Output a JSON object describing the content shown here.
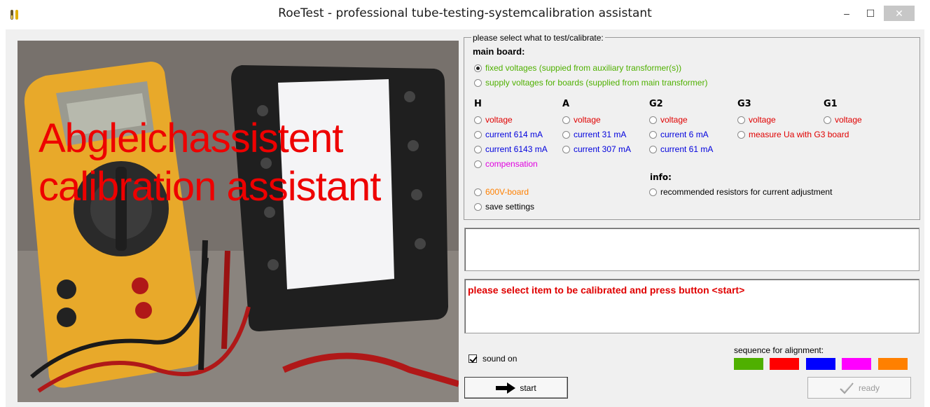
{
  "window": {
    "title": "RoeTest - professional tube-testing-systemcalibration assistant",
    "minimize": "–",
    "maximize": "☐",
    "close": "✕"
  },
  "photo": {
    "overlay_line1": "Abgleichassistent",
    "overlay_line2": "calibration assistant",
    "overlay_color": "#ee0000"
  },
  "groupbox": {
    "legend": "please select what to test/calibrate:",
    "main_board": {
      "title": "main board:",
      "options": [
        {
          "label": "fixed voltages (suppied from auxiliary transformer(s))",
          "checked": true
        },
        {
          "label": "supply voltages for boards (supplied from main transformer)",
          "checked": false
        }
      ]
    },
    "columns": {
      "H": {
        "heading": "H",
        "options": [
          "voltage",
          "current 614 mA",
          "current 6143 mA",
          "compensation"
        ]
      },
      "A": {
        "heading": "A",
        "options": [
          "voltage",
          "current 31 mA",
          "current 307 mA"
        ]
      },
      "G2": {
        "heading": "G2",
        "options": [
          "voltage",
          "current 6 mA",
          "current 61 mA"
        ]
      },
      "G3": {
        "heading": "G3",
        "options": [
          "voltage",
          "measure Ua with G3 board"
        ]
      },
      "G1": {
        "heading": "G1",
        "options": [
          "voltage"
        ]
      }
    },
    "board_600v": "600V-board",
    "save_settings": "save settings",
    "info": {
      "title": "info:",
      "option": "recommended resistors for current adjustment"
    }
  },
  "status": {
    "box1_text": "",
    "message": "please select item to be calibrated and press button <start>"
  },
  "sound": {
    "label": "sound on",
    "checked": true
  },
  "sequence": {
    "label": "sequence for alignment:",
    "colors": [
      "#4fb000",
      "#ff0000",
      "#0000ff",
      "#ff00ff",
      "#ff8000"
    ]
  },
  "buttons": {
    "start": "start",
    "ready": "ready"
  }
}
